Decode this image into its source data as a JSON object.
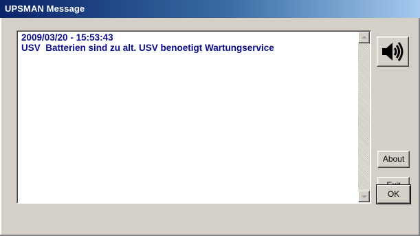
{
  "window": {
    "title": "UPSMAN Message"
  },
  "message": {
    "line1": "2009/03/20 - 15:53:43",
    "line2": "USV  Batterien sind zu alt. USV benoetigt Wartungservice",
    "text_color": "#0a0a8c"
  },
  "buttons": {
    "speaker_icon": "speaker-volume-icon",
    "about": "About",
    "exit": "Exit",
    "ok": "OK"
  },
  "colors": {
    "titlebar_start": "#0a246a",
    "titlebar_end": "#a6caf0",
    "face": "#d4d0c8"
  }
}
